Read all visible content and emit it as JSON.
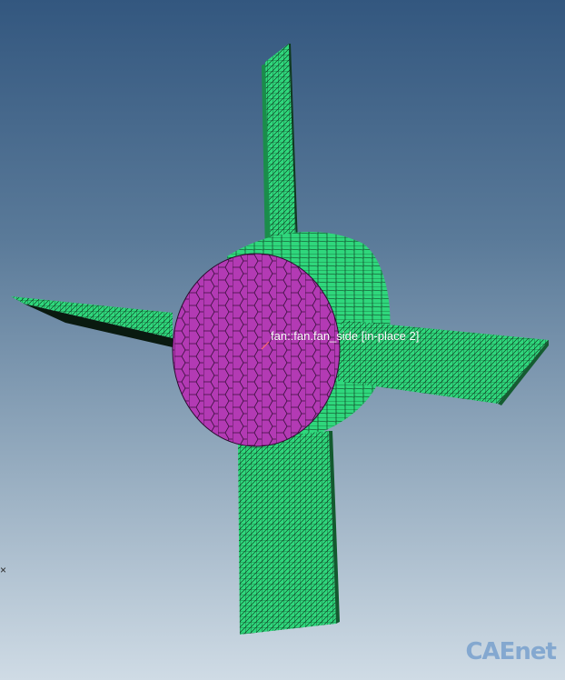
{
  "viewport": {
    "probe_label": "fan::fan.fan_side [in-place 2]",
    "left_mark": "×",
    "watermark": "CAEnet"
  },
  "colors": {
    "fan_blade": "#2fd77c",
    "fan_blade_dark": "#1a8d4a",
    "fan_face": "#b33ab4",
    "mesh_line": "#0b2a16",
    "background_top": "#33577f",
    "background_bottom": "#cfdbe5"
  }
}
